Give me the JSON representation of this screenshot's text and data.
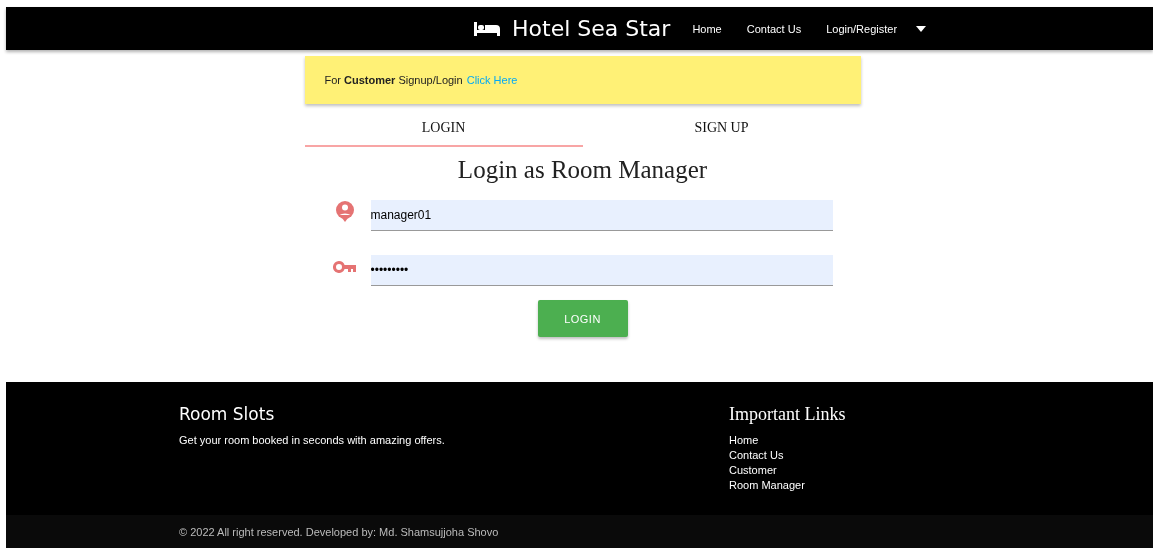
{
  "navbar": {
    "brand": "Hotel Sea Star",
    "links": [
      "Home",
      "Contact Us",
      "Login/Register"
    ]
  },
  "notice": {
    "text": "For **Customer** Signup/Login",
    "link": "Click Here"
  },
  "tabs": [
    {
      "label": "LOGIN",
      "selected": true
    },
    {
      "label": "SIGN UP",
      "selected": false
    }
  ],
  "heading": "Login as Room Manager",
  "fields": [
    {
      "kind": "user",
      "value": "manager01"
    },
    {
      "kind": "key",
      "value": "•••••••••"
    }
  ],
  "submit": "LOGIN",
  "footer": {
    "title": "Room Slots",
    "tagline": "Get your room booked in seconds with amazing offers.",
    "links_title": "Important Links",
    "links": [
      "Home",
      "Contact Us",
      "Customer",
      "Room Manager"
    ],
    "copyright": "© 2022 All right reserved. Developed by: Md. Shamsujjoha Shovo"
  }
}
